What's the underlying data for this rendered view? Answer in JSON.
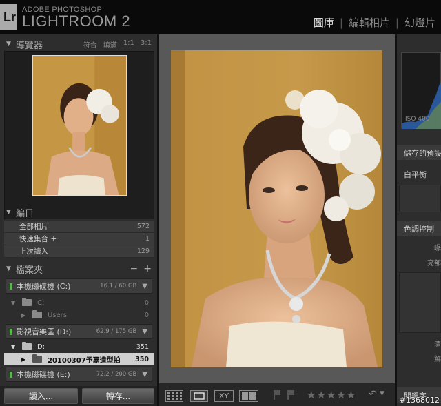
{
  "app": {
    "badge": "Lr",
    "vendor": "ADOBE PHOTOSHOP",
    "product": "LIGHTROOM 2",
    "modules": [
      {
        "label": "圖庫",
        "active": true
      },
      {
        "label": "編輯相片",
        "active": false
      },
      {
        "label": "幻燈片",
        "active": false
      }
    ]
  },
  "navigator": {
    "title": "導覽器",
    "zoom_options": [
      "符合",
      "填滿",
      "1:1",
      "3:1"
    ]
  },
  "catalog": {
    "title": "編目",
    "items": [
      {
        "label": "全部相片",
        "count": "572"
      },
      {
        "label": "快速集合 +",
        "count": "1"
      },
      {
        "label": "上次讀入",
        "count": "129"
      }
    ]
  },
  "folders": {
    "title": "檔案夾",
    "add": "+",
    "remove": "−",
    "volumes": [
      {
        "name": "本機磁碟機 (C:)",
        "space": "16.1 / 60 GB"
      },
      {
        "name": "影視音樂區 (D:)",
        "space": "62.9 / 175 GB"
      },
      {
        "name": "本機磁碟機 (E:)",
        "space": "72.2 / 200 GB"
      }
    ],
    "rows": [
      {
        "name": "C:",
        "count": "0"
      },
      {
        "name": "Users",
        "count": "0"
      },
      {
        "name": "D:",
        "count": "351"
      },
      {
        "name": "20100307予嘉造型拍",
        "count": "350"
      }
    ]
  },
  "buttons": {
    "import": "讀入...",
    "export": "轉存..."
  },
  "toolbar": {
    "compare_label": "XY",
    "stars": "★★★★★"
  },
  "right_panel": {
    "iso": "ISO 400",
    "saved_preset": "儲存的預設",
    "white_balance": "白平衡",
    "tone_control": "色調控制",
    "frag_1": "曝",
    "frag_2": "亮部",
    "frag_3": "清",
    "frag_4": "鮮",
    "bottom": "關鍵字"
  },
  "watermark": "#1368012",
  "colors": {
    "accent_green": "#4fbf3f",
    "panel": "#2d2d2d",
    "center_bg": "#585858"
  }
}
